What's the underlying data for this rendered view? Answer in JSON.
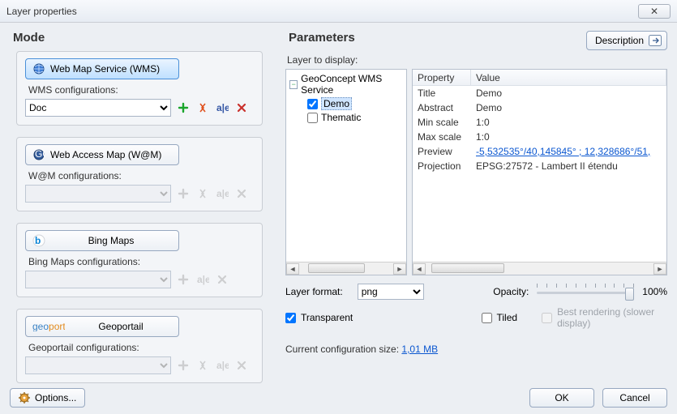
{
  "title": "Layer properties",
  "sections": {
    "mode": "Mode",
    "parameters": "Parameters"
  },
  "description_btn": "Description",
  "modes": {
    "wms": {
      "label": "Web Map Service (WMS)",
      "cfg_label": "WMS configurations:",
      "selected": "Doc"
    },
    "wam": {
      "label": "Web Access Map (W@M)",
      "cfg_label": "W@M configurations:"
    },
    "bing": {
      "label": "Bing Maps",
      "cfg_label": "Bing Maps  configurations:"
    },
    "geo": {
      "label": "Geoportail",
      "cfg_label": "Geoportail configurations:"
    }
  },
  "layer_to_display_label": "Layer to display:",
  "tree": {
    "root": "GeoConcept WMS Service",
    "children": [
      {
        "label": "Demo",
        "checked": true,
        "selected": true
      },
      {
        "label": "Thematic",
        "checked": false,
        "selected": false
      }
    ]
  },
  "prop_header": {
    "property": "Property",
    "value": "Value"
  },
  "properties": [
    {
      "name": "Title",
      "value": "Demo"
    },
    {
      "name": "Abstract",
      "value": "Demo"
    },
    {
      "name": "Min scale",
      "value": "1:0"
    },
    {
      "name": "Max scale",
      "value": "1:0"
    },
    {
      "name": "Preview",
      "value": "-5,532535°/40,145845° ; 12,328686°/51,",
      "link": true
    },
    {
      "name": "Projection",
      "value": "EPSG:27572 - Lambert II étendu"
    }
  ],
  "layer_format_label": "Layer format:",
  "layer_format_value": "png",
  "opacity_label": "Opacity:",
  "opacity_value": "100%",
  "transparent_label": "Transparent",
  "transparent_checked": true,
  "tiled_label": "Tiled",
  "tiled_checked": false,
  "best_rendering_label": "Best rendering (slower display)",
  "config_size_label": "Current configuration size: ",
  "config_size_value": "1,01 MB",
  "options_btn": "Options...",
  "ok_btn": "OK",
  "cancel_btn": "Cancel"
}
